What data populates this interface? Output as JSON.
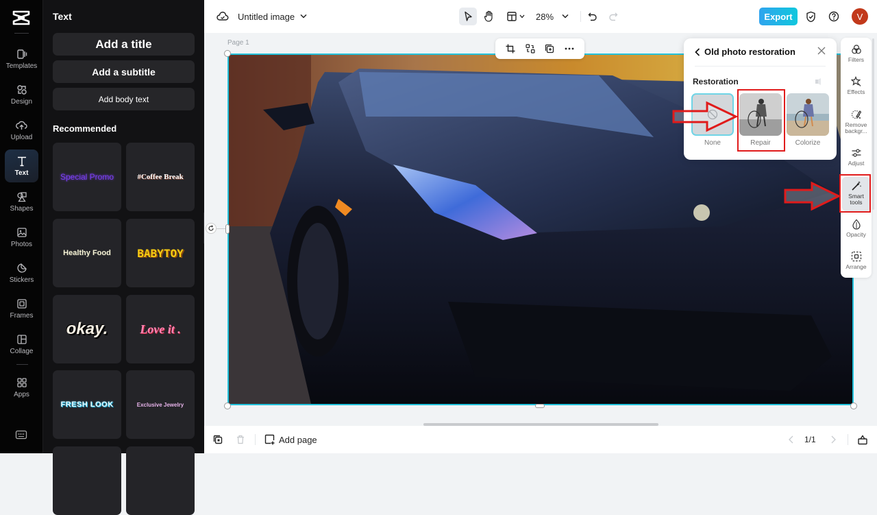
{
  "app": {
    "brand": "CapCut"
  },
  "rail": {
    "items": [
      {
        "label": "Templates",
        "icon": "templates-icon"
      },
      {
        "label": "Design",
        "icon": "design-icon"
      },
      {
        "label": "Upload",
        "icon": "upload-cloud-icon"
      },
      {
        "label": "Text",
        "icon": "text-icon",
        "active": true
      },
      {
        "label": "Shapes",
        "icon": "shapes-icon"
      },
      {
        "label": "Photos",
        "icon": "photos-icon"
      },
      {
        "label": "Stickers",
        "icon": "stickers-icon"
      },
      {
        "label": "Frames",
        "icon": "frames-icon"
      },
      {
        "label": "Collage",
        "icon": "collage-icon"
      },
      {
        "label": "Apps",
        "icon": "apps-icon"
      }
    ]
  },
  "panel": {
    "title": "Text",
    "add_title": "Add a title",
    "add_subtitle": "Add a subtitle",
    "add_body": "Add body text",
    "recommended": "Recommended",
    "presets": [
      "Special Promo",
      "#Coffee Break",
      "Healthy Food",
      "BABYTOY",
      "okay.",
      "Love it .",
      "FRESH LOOK",
      "Exclusive Jewelry"
    ]
  },
  "topbar": {
    "doc_title": "Untitled image",
    "zoom": "28%",
    "export_label": "Export",
    "avatar_initial": "V",
    "colors": {
      "export_start": "#2fa4ee",
      "export_end": "#10c7dd",
      "avatar": "#c2391b"
    }
  },
  "canvas": {
    "page_label": "Page 1",
    "selection_color": "#22c3dd"
  },
  "old_photo": {
    "title": "Old photo restoration",
    "section": "Restoration",
    "options": [
      {
        "label": "None",
        "selected": true
      },
      {
        "label": "Repair",
        "highlighted": true
      },
      {
        "label": "Colorize"
      }
    ]
  },
  "right_tools": {
    "items": [
      {
        "label": "Filters",
        "icon": "filters-icon"
      },
      {
        "label": "Effects",
        "icon": "effects-icon"
      },
      {
        "label": "Remove backgr...",
        "icon": "remove-background-icon"
      },
      {
        "label": "Adjust",
        "icon": "adjust-icon"
      },
      {
        "label": "Smart tools",
        "icon": "magic-wand-icon",
        "active": true
      },
      {
        "label": "Opacity",
        "icon": "opacity-icon"
      },
      {
        "label": "Arrange",
        "icon": "arrange-icon"
      }
    ]
  },
  "bottombar": {
    "add_page": "Add page",
    "page_counter": "1/1"
  },
  "annotation_color": "#e01b1b"
}
